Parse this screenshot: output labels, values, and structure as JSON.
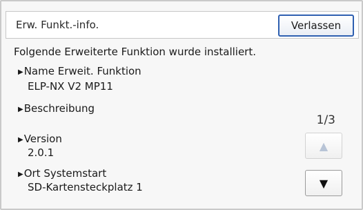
{
  "header": {
    "title": "Erw. Funkt.-info.",
    "exit_label": "Verlassen"
  },
  "main": {
    "intro": "Folgende Erweiterte Funktion wurde installiert.",
    "items": [
      {
        "label": "Name Erweit. Funktion",
        "value": "ELP-NX V2 MP11"
      },
      {
        "label": "Beschreibung",
        "value": ""
      },
      {
        "label": "Version",
        "value": "2.0.1"
      },
      {
        "label": "Ort Systemstart",
        "value": "SD-Kartensteckplatz 1"
      }
    ]
  },
  "pager": {
    "indicator": "1/3",
    "up_icon": "▲",
    "down_icon": "▼"
  },
  "icons": {
    "bullet": "▶"
  }
}
